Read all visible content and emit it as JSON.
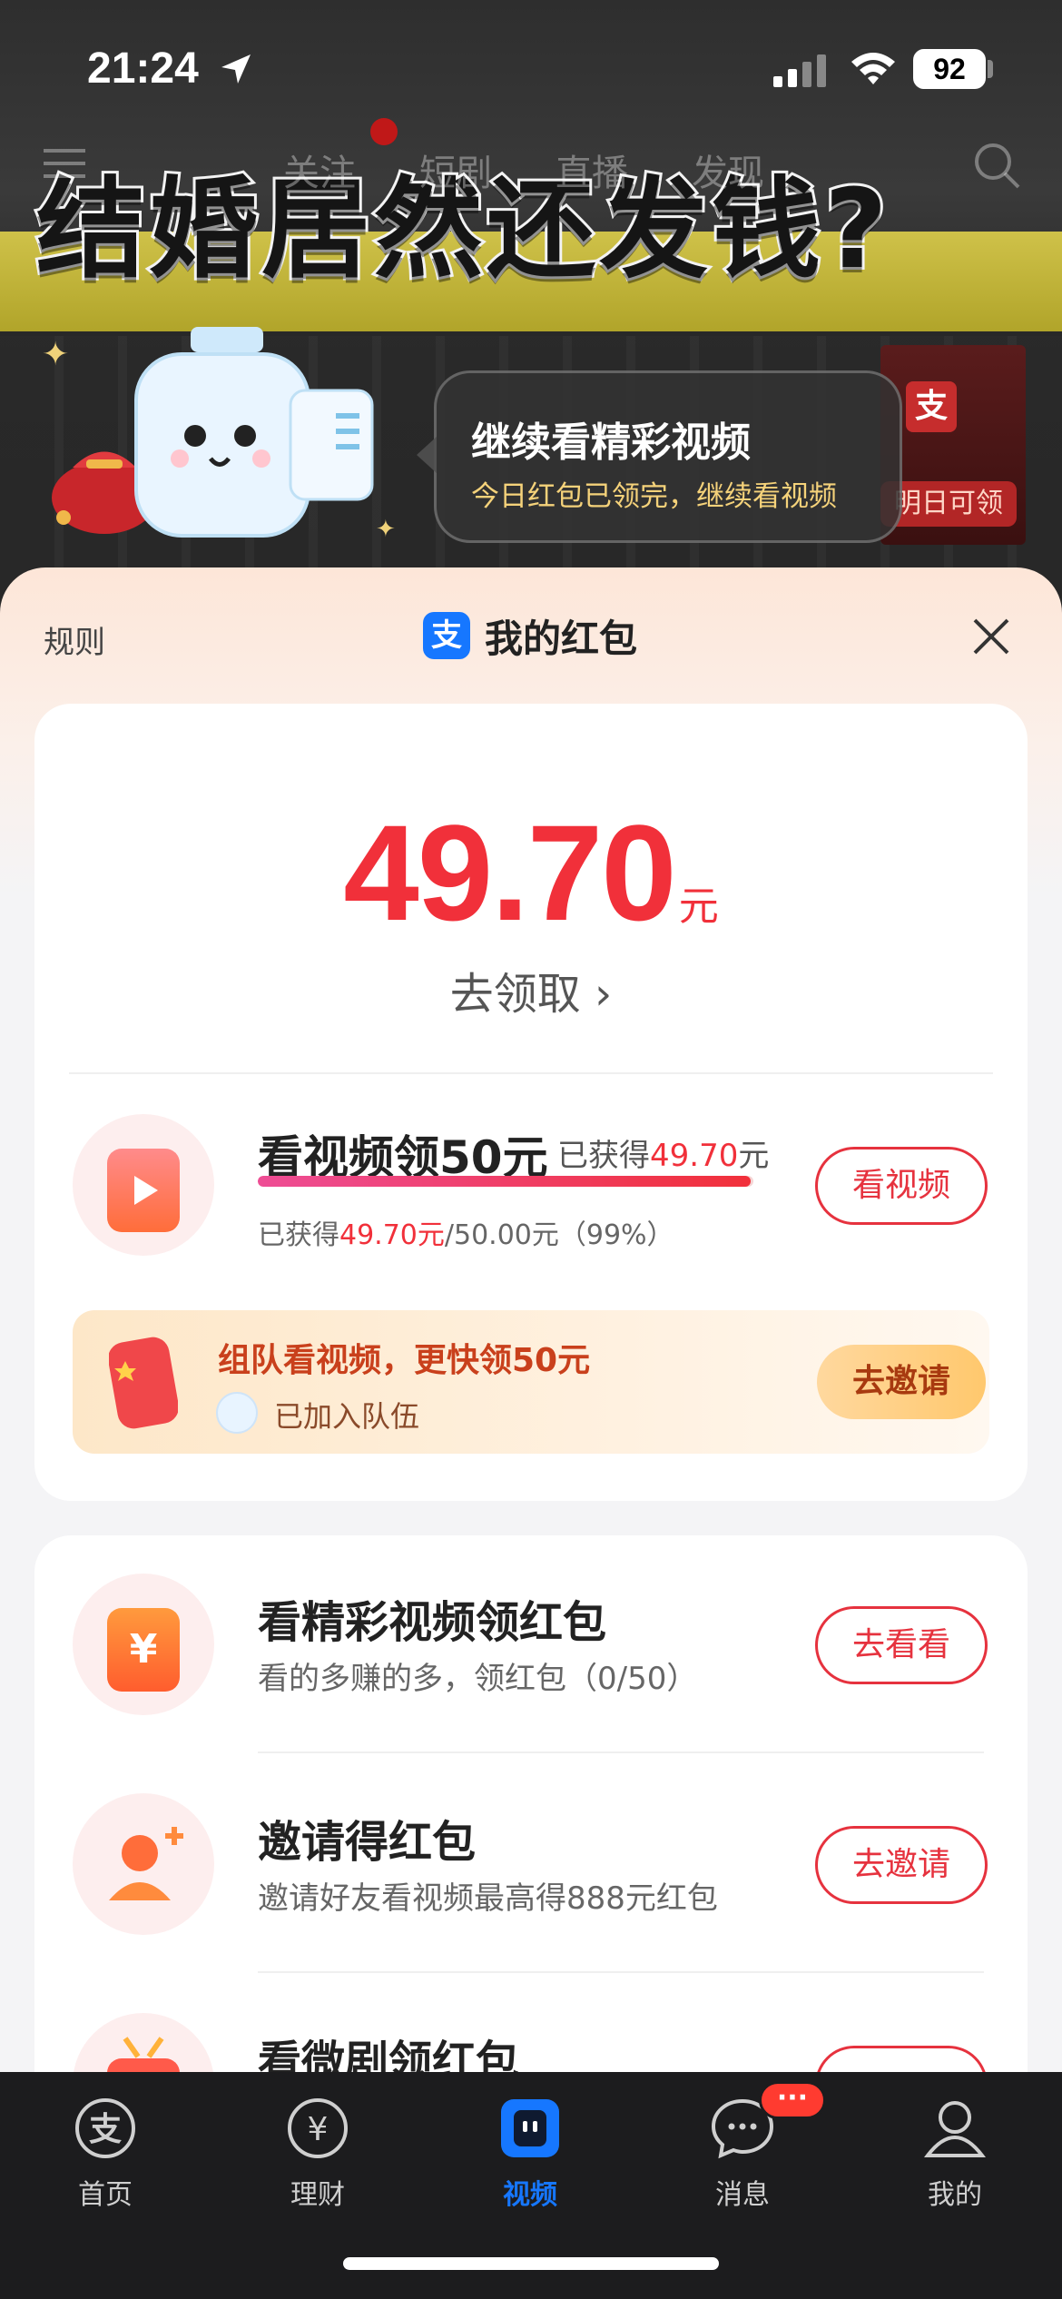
{
  "status_bar": {
    "time": "21:24",
    "battery": "92"
  },
  "video": {
    "top_tabs": [
      "关注",
      "短剧",
      "直播",
      "发现"
    ],
    "headline": "结婚居然还发钱?",
    "bubble_title": "继续看精彩视频",
    "bubble_sub": "今日红包已领完，继续看视频",
    "sign_logo": "支",
    "sign_text": "明日可领"
  },
  "sheet": {
    "rules": "规则",
    "logo": "支",
    "title": "我的红包",
    "amount": "49.70",
    "amount_unit": "元",
    "claim": "去领取 ›"
  },
  "task_main": {
    "title": "看视频领50元",
    "earned_prefix": "已获得",
    "earned_value": "49.70",
    "earned_suffix": "元",
    "progress_prefix": "已获得",
    "progress_value": "49.70元",
    "progress_total": "/50.00元（99%）",
    "progress_fraction": 0.994,
    "button": "看视频"
  },
  "team": {
    "title": "组队看视频，更快领50元",
    "joined": "已加入队伍",
    "button": "去邀请"
  },
  "tasks": [
    {
      "title": "看精彩视频领红包",
      "sub": "看的多赚的多，领红包（0/50）",
      "button": "去看看"
    },
    {
      "title": "邀请得红包",
      "sub": "邀请好友看视频最高得888元红包",
      "button": "去邀请"
    },
    {
      "title": "看微剧领红包"
    }
  ],
  "tabbar": {
    "items": [
      {
        "label": "首页",
        "icon": "alipay-icon"
      },
      {
        "label": "理财",
        "icon": "yen-icon"
      },
      {
        "label": "视频",
        "icon": "video-icon"
      },
      {
        "label": "消息",
        "icon": "message-icon"
      },
      {
        "label": "我的",
        "icon": "profile-icon"
      }
    ],
    "active": "视频",
    "message_badge": "···"
  },
  "colors": {
    "accent_red": "#f1303a",
    "brand_blue": "#1677ff",
    "tabbar_bg": "#1c1c1e"
  }
}
